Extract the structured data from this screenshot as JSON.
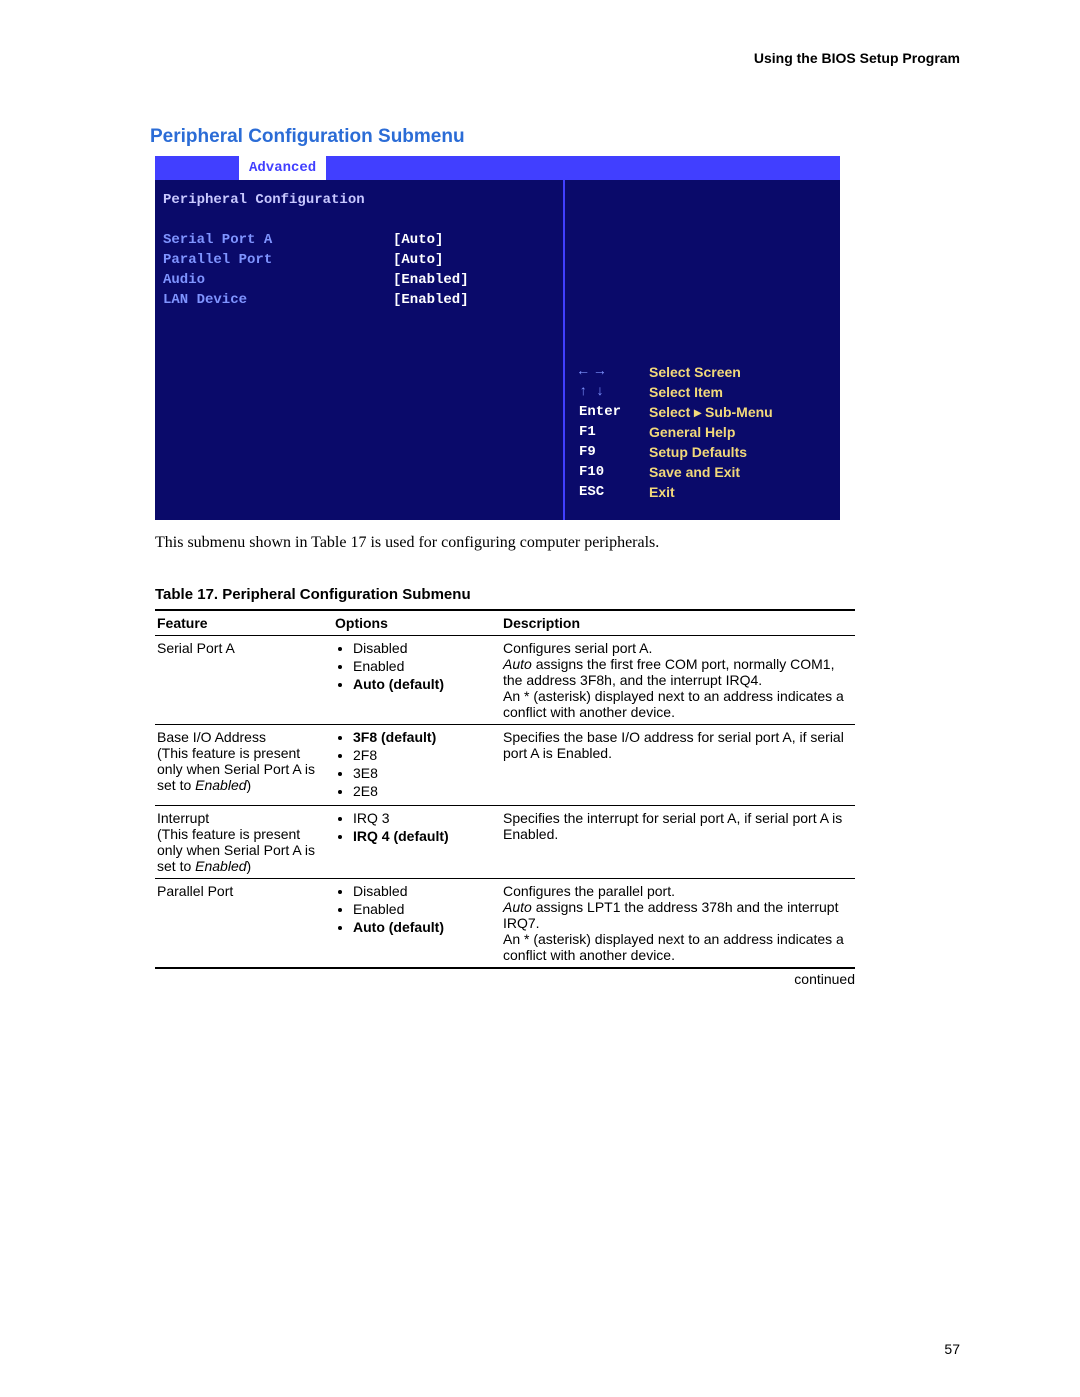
{
  "header": "Using the BIOS Setup Program",
  "section_title": "Peripheral Configuration Submenu",
  "bios": {
    "tab": "Advanced",
    "heading": "Peripheral Configuration",
    "items": [
      {
        "label": "Serial Port A",
        "value": "[Auto]"
      },
      {
        "label": "Parallel Port",
        "value": "[Auto]"
      },
      {
        "label": "Audio",
        "value": "[Enabled]"
      },
      {
        "label": "LAN Device",
        "value": "[Enabled]"
      }
    ],
    "help": [
      {
        "key": "← →",
        "sym": true,
        "desc": "Select Screen"
      },
      {
        "key": "↑ ↓",
        "sym": true,
        "desc": "Select Item"
      },
      {
        "key": "Enter",
        "sym": false,
        "desc": "Select ▸ Sub-Menu"
      },
      {
        "key": "F1",
        "sym": false,
        "desc": "General Help"
      },
      {
        "key": "F9",
        "sym": false,
        "desc": "Setup Defaults"
      },
      {
        "key": "F10",
        "sym": false,
        "desc": "Save and Exit"
      },
      {
        "key": "ESC",
        "sym": false,
        "desc": "Exit"
      }
    ]
  },
  "caption_para": "This submenu shown in Table 17 is used for configuring computer peripherals.",
  "table_title": "Table 17.    Peripheral Configuration Submenu",
  "columns": {
    "c1": "Feature",
    "c2": "Options",
    "c3": "Description"
  },
  "rows": [
    {
      "feature_main": "Serial Port A",
      "feature_note_parts": [],
      "options": [
        {
          "t": "Disabled",
          "b": false
        },
        {
          "t": "Enabled",
          "b": false
        },
        {
          "t": "Auto (default)",
          "b": true
        }
      ],
      "desc": [
        {
          "t": "Configures serial port A.",
          "style": ""
        },
        {
          "t": [
            "italic|Auto",
            " assigns the first free COM port, normally COM1, the address 3F8h, and the interrupt IRQ4."
          ]
        },
        {
          "t": "An * (asterisk) displayed next to an address indicates a conflict with another device.",
          "style": ""
        }
      ]
    },
    {
      "feature_main": "Base I/O Address",
      "feature_note_parts": [
        "(This feature is present only when Serial Port A is set to ",
        "italic|Enabled",
        ")"
      ],
      "options": [
        {
          "t": "3F8 (default)",
          "b": true
        },
        {
          "t": "2F8",
          "b": false
        },
        {
          "t": "3E8",
          "b": false
        },
        {
          "t": "2E8",
          "b": false
        }
      ],
      "desc": [
        {
          "t": "Specifies the base I/O address for serial port A, if serial port A is Enabled.",
          "style": ""
        }
      ]
    },
    {
      "feature_main": "Interrupt",
      "feature_note_parts": [
        "(This feature is present only when Serial Port A is set to ",
        "italic|Enabled",
        ")"
      ],
      "options": [
        {
          "t": "IRQ 3",
          "b": false
        },
        {
          "t": "IRQ 4 (default)",
          "b": true
        }
      ],
      "desc": [
        {
          "t": "Specifies the interrupt for serial port A, if serial port A is Enabled.",
          "style": ""
        }
      ]
    },
    {
      "feature_main": "Parallel Port",
      "feature_note_parts": [],
      "options": [
        {
          "t": "Disabled",
          "b": false
        },
        {
          "t": "Enabled",
          "b": false
        },
        {
          "t": "Auto (default)",
          "b": true
        }
      ],
      "desc": [
        {
          "t": "Configures the parallel port.",
          "style": ""
        },
        {
          "t": [
            "italic|Auto",
            " assigns LPT1 the address 378h and the interrupt IRQ7."
          ]
        },
        {
          "t": "An * (asterisk) displayed next to an address indicates a conflict with another device.",
          "style": ""
        }
      ]
    }
  ],
  "continued": "continued",
  "page_num": "57"
}
